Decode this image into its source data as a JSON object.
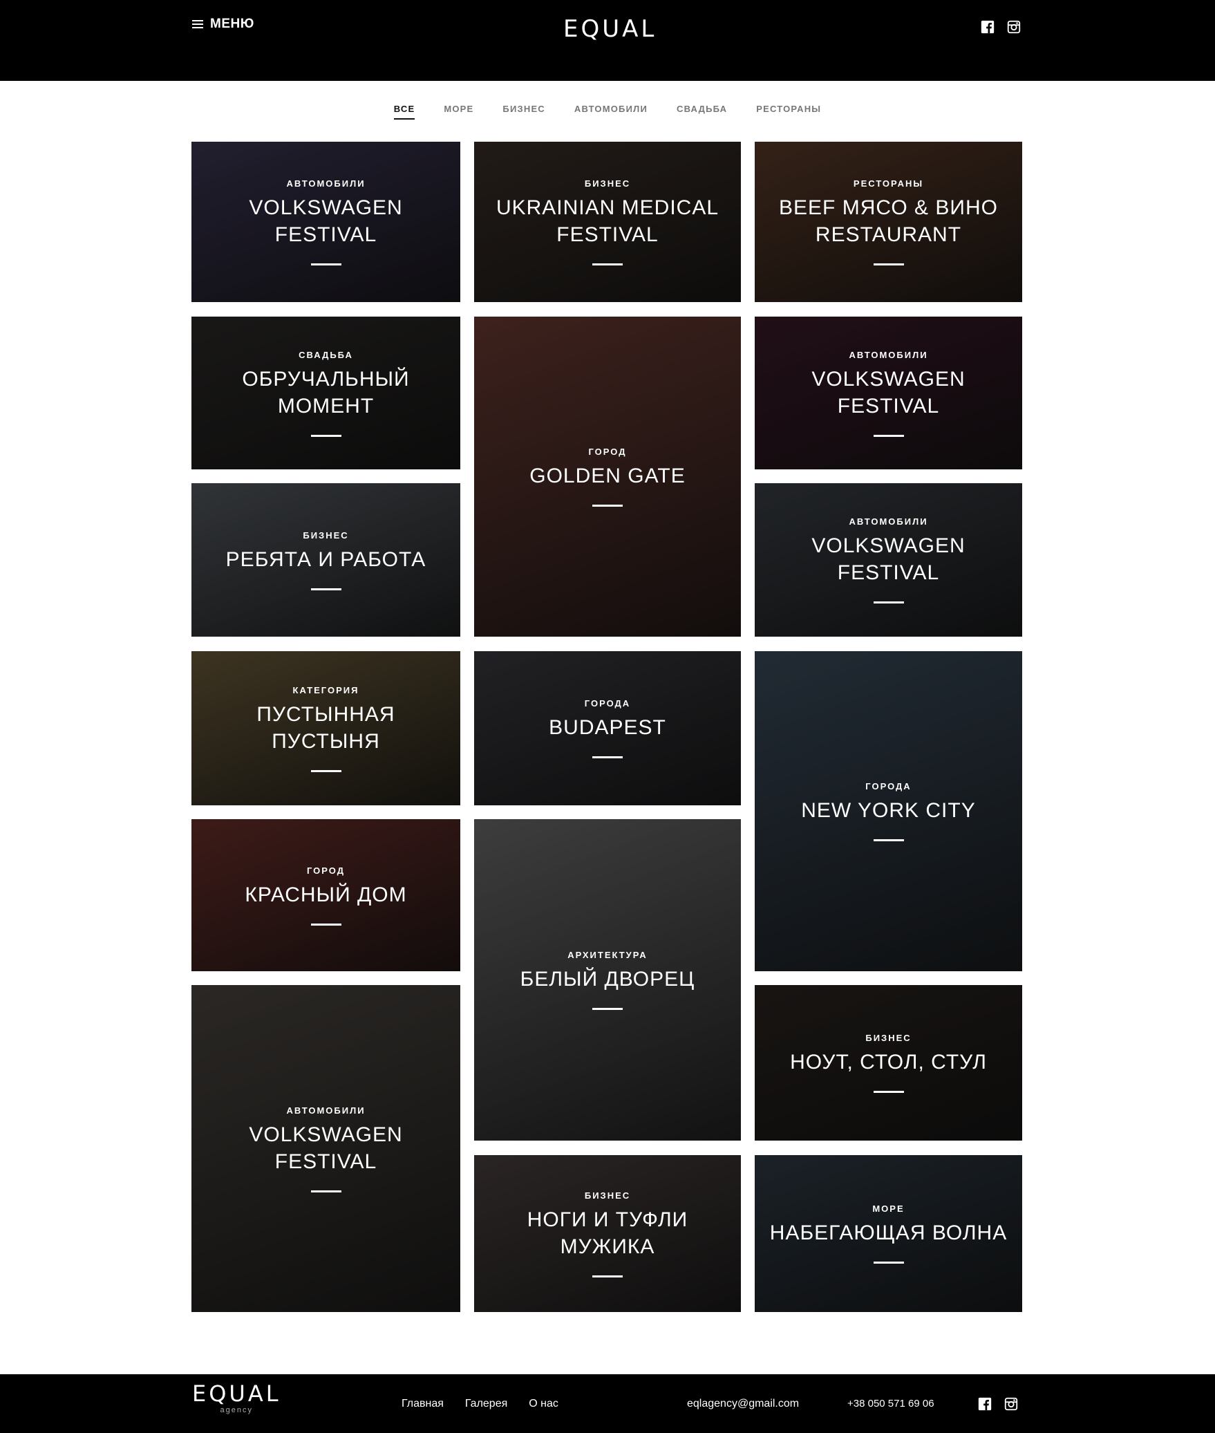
{
  "header": {
    "menu_label": "МЕНЮ",
    "logo": "EQUAL",
    "social": [
      "facebook-icon",
      "instagram-icon"
    ]
  },
  "filters": {
    "tabs": [
      {
        "label": "ВСЕ",
        "active": true
      },
      {
        "label": "МОРЕ"
      },
      {
        "label": "БИЗНЕС"
      },
      {
        "label": "АВТОМОБИЛИ"
      },
      {
        "label": "СВАДЬБА"
      },
      {
        "label": "РЕСТОРАНЫ"
      }
    ]
  },
  "gallery": [
    {
      "category": "АВТОМОБИЛИ",
      "title": "VOLKSWAGEN FESTIVAL",
      "color": "#3b3552"
    },
    {
      "category": "БИЗНЕС",
      "title": "UKRAINIAN MEDICAL FESTIVAL",
      "color": "#3a2f28"
    },
    {
      "category": "РЕСТОРАНЫ",
      "title": "BEEF МЯСО & ВИНО RESTAURANT",
      "color": "#5a3a28"
    },
    {
      "category": "СВАДЬБА",
      "title": "ОБРУЧАЛЬНЫЙ МОМЕНТ",
      "color": "#2c2a28"
    },
    {
      "category": "ГОРОД",
      "title": "GOLDEN GATE",
      "color": "#6a3a32"
    },
    {
      "category": "АВТОМОБИЛИ",
      "title": "VOLKSWAGEN FESTIVAL",
      "color": "#3a1a2a"
    },
    {
      "category": "БИЗНЕС",
      "title": "РЕБЯТА И РАБОТА",
      "color": "#555a60"
    },
    {
      "category": "АВТОМОБИЛИ",
      "title": "VOLKSWAGEN FESTIVAL",
      "color": "#3a3f45"
    },
    {
      "category": "КАТЕГОРИЯ",
      "title": "ПУСТЫННАЯ ПУСТЫНЯ",
      "color": "#6a5a3a"
    },
    {
      "category": "ГОРОДА",
      "title": "BUDAPEST",
      "color": "#3a3a40"
    },
    {
      "category": "ГОРОДА",
      "title": "NEW YORK CITY",
      "color": "#3a4a5a"
    },
    {
      "category": "ГОРОД",
      "title": "КРАСНЫЙ ДОМ",
      "color": "#6a2f2a"
    },
    {
      "category": "АРХИТЕКТУРА",
      "title": "БЕЛЫЙ ДВОРЕЦ",
      "color": "#6a6a6a"
    },
    {
      "category": "АВТОМОБИЛИ",
      "title": "VOLKSWAGEN FESTIVAL",
      "color": "#4a4540"
    },
    {
      "category": "БИЗНЕС",
      "title": "НОУТ, СТОЛ, СТУЛ",
      "color": "#2a2420"
    },
    {
      "category": "БИЗНЕС",
      "title": "НОГИ И ТУФЛИ МУЖИКА",
      "color": "#4a4040"
    },
    {
      "category": "МОРЕ",
      "title": "НАБЕГАЮЩАЯ ВОЛНА",
      "color": "#2f3a45"
    }
  ],
  "footer": {
    "logo": "EQUAL",
    "logo_sub": "agency",
    "nav": [
      "Главная",
      "Галерея",
      "О нас"
    ],
    "email": "eqlagency@gmail.com",
    "phone": "+38 050 571 69 06"
  }
}
